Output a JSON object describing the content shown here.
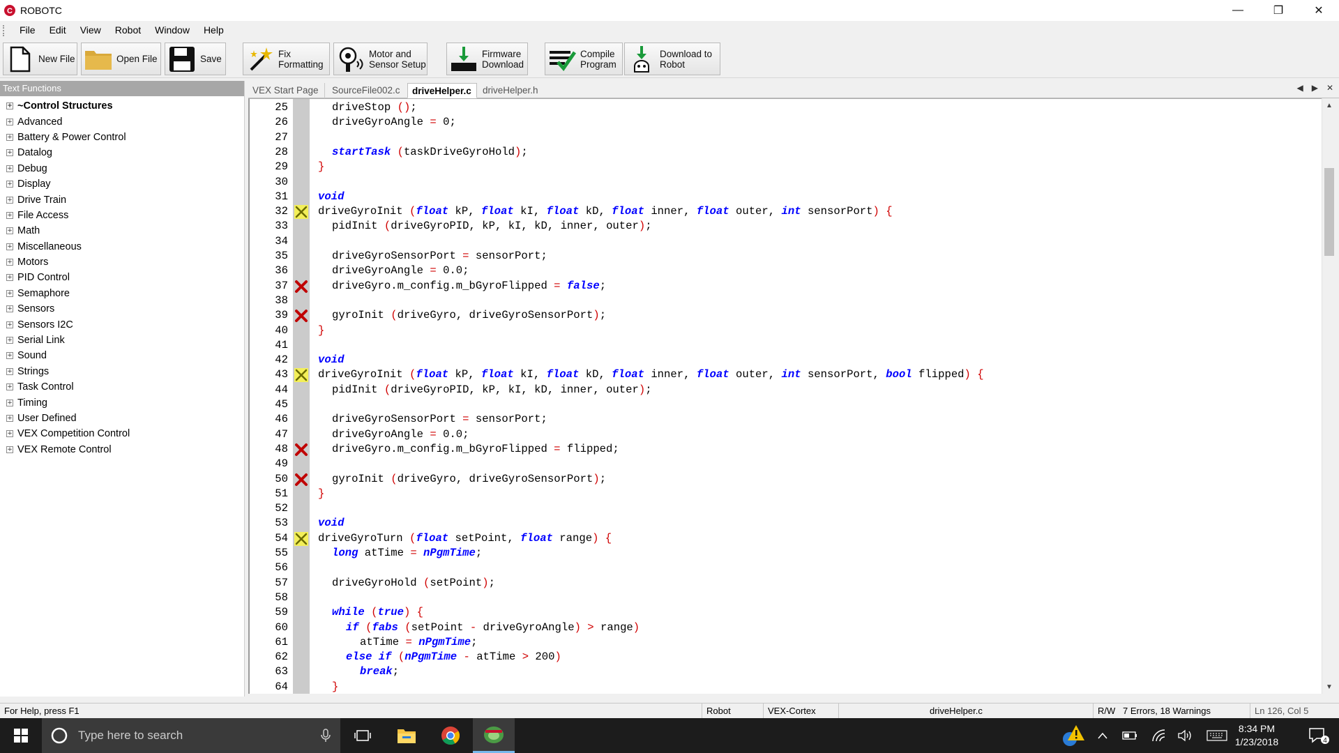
{
  "window": {
    "title": "ROBOTC"
  },
  "menu": [
    "File",
    "Edit",
    "View",
    "Robot",
    "Window",
    "Help"
  ],
  "toolbar": {
    "new_file": "New File",
    "open_file": "Open File",
    "save": "Save",
    "fix_formatting": "Fix\nFormatting",
    "motor_sensor": "Motor and\nSensor Setup",
    "firmware_download": "Firmware\nDownload",
    "compile_program": "Compile\nProgram",
    "download_robot": "Download to\nRobot"
  },
  "panel": {
    "header": "Text Functions",
    "items": [
      "~Control Structures",
      "Advanced",
      "Battery & Power Control",
      "Datalog",
      "Debug",
      "Display",
      "Drive Train",
      "File Access",
      "Math",
      "Miscellaneous",
      "Motors",
      "PID Control",
      "Semaphore",
      "Sensors",
      "Sensors I2C",
      "Serial Link",
      "Sound",
      "Strings",
      "Task Control",
      "Timing",
      "User Defined",
      "VEX Competition Control",
      "VEX Remote Control"
    ]
  },
  "tabs": [
    "VEX Start Page",
    "SourceFile002.c",
    "driveHelper.c",
    "driveHelper.h"
  ],
  "active_tab": 2,
  "code": [
    {
      "n": "25",
      "mark": "",
      "indent": 1,
      "t": "driveStop ();"
    },
    {
      "n": "26",
      "mark": "",
      "indent": 1,
      "t": "driveGyroAngle = 0;"
    },
    {
      "n": "27",
      "mark": "",
      "indent": 0,
      "t": ""
    },
    {
      "n": "28",
      "mark": "",
      "indent": 1,
      "t": "startTask (taskDriveGyroHold);"
    },
    {
      "n": "29",
      "mark": "",
      "indent": 0,
      "t": "}"
    },
    {
      "n": "30",
      "mark": "",
      "indent": 0,
      "t": ""
    },
    {
      "n": "31",
      "mark": "",
      "indent": 0,
      "t": "void"
    },
    {
      "n": "32",
      "mark": "warning",
      "indent": 0,
      "t": "driveGyroInit (float kP, float kI, float kD, float inner, float outer, int sensorPort) {"
    },
    {
      "n": "33",
      "mark": "",
      "indent": 1,
      "t": "pidInit (driveGyroPID, kP, kI, kD, inner, outer);"
    },
    {
      "n": "34",
      "mark": "",
      "indent": 0,
      "t": ""
    },
    {
      "n": "35",
      "mark": "",
      "indent": 1,
      "t": "driveGyroSensorPort = sensorPort;"
    },
    {
      "n": "36",
      "mark": "",
      "indent": 1,
      "t": "driveGyroAngle = 0.0;"
    },
    {
      "n": "37",
      "mark": "error",
      "indent": 1,
      "t": "driveGyro.m_config.m_bGyroFlipped = false;"
    },
    {
      "n": "38",
      "mark": "",
      "indent": 0,
      "t": ""
    },
    {
      "n": "39",
      "mark": "error",
      "indent": 1,
      "t": "gyroInit (driveGyro, driveGyroSensorPort);"
    },
    {
      "n": "40",
      "mark": "",
      "indent": 0,
      "t": "}"
    },
    {
      "n": "41",
      "mark": "",
      "indent": 0,
      "t": ""
    },
    {
      "n": "42",
      "mark": "",
      "indent": 0,
      "t": "void"
    },
    {
      "n": "43",
      "mark": "warning",
      "indent": 0,
      "t": "driveGyroInit (float kP, float kI, float kD, float inner, float outer, int sensorPort, bool flipped) {"
    },
    {
      "n": "44",
      "mark": "",
      "indent": 1,
      "t": "pidInit (driveGyroPID, kP, kI, kD, inner, outer);"
    },
    {
      "n": "45",
      "mark": "",
      "indent": 0,
      "t": ""
    },
    {
      "n": "46",
      "mark": "",
      "indent": 1,
      "t": "driveGyroSensorPort = sensorPort;"
    },
    {
      "n": "47",
      "mark": "",
      "indent": 1,
      "t": "driveGyroAngle = 0.0;"
    },
    {
      "n": "48",
      "mark": "error",
      "indent": 1,
      "t": "driveGyro.m_config.m_bGyroFlipped = flipped;"
    },
    {
      "n": "49",
      "mark": "",
      "indent": 0,
      "t": ""
    },
    {
      "n": "50",
      "mark": "error",
      "indent": 1,
      "t": "gyroInit (driveGyro, driveGyroSensorPort);"
    },
    {
      "n": "51",
      "mark": "",
      "indent": 0,
      "t": "}"
    },
    {
      "n": "52",
      "mark": "",
      "indent": 0,
      "t": ""
    },
    {
      "n": "53",
      "mark": "",
      "indent": 0,
      "t": "void"
    },
    {
      "n": "54",
      "mark": "warning",
      "indent": 0,
      "t": "driveGyroTurn (float setPoint, float range) {"
    },
    {
      "n": "55",
      "mark": "",
      "indent": 1,
      "t": "long atTime = nPgmTime;"
    },
    {
      "n": "56",
      "mark": "",
      "indent": 0,
      "t": ""
    },
    {
      "n": "57",
      "mark": "",
      "indent": 1,
      "t": "driveGyroHold (setPoint);"
    },
    {
      "n": "58",
      "mark": "",
      "indent": 0,
      "t": ""
    },
    {
      "n": "59",
      "mark": "",
      "indent": 1,
      "t": "while (true) {"
    },
    {
      "n": "60",
      "mark": "",
      "indent": 2,
      "t": "if (fabs (setPoint - driveGyroAngle) > range)"
    },
    {
      "n": "61",
      "mark": "",
      "indent": 3,
      "t": "atTime = nPgmTime;"
    },
    {
      "n": "62",
      "mark": "",
      "indent": 2,
      "t": "else if (nPgmTime - atTime > 200)"
    },
    {
      "n": "63",
      "mark": "",
      "indent": 3,
      "t": "break;"
    },
    {
      "n": "64",
      "mark": "",
      "indent": 1,
      "t": "}"
    }
  ],
  "status": {
    "help": "For Help, press F1",
    "robot": "Robot",
    "platform": "VEX-Cortex",
    "file": "driveHelper.c",
    "mode": "R/W",
    "errors": "7 Errors, 18 Warnings",
    "cursor": "Ln 126, Col 5"
  },
  "taskbar": {
    "search_placeholder": "Type here to search",
    "time": "8:34 PM",
    "date": "1/23/2018",
    "notification_count": "4"
  },
  "colors": {
    "keyword": "#0000ff",
    "operator": "#d00000",
    "gutter": "#cbcbcb",
    "panel_header": "#a7a7a7",
    "taskbar": "#1c1c1c"
  }
}
